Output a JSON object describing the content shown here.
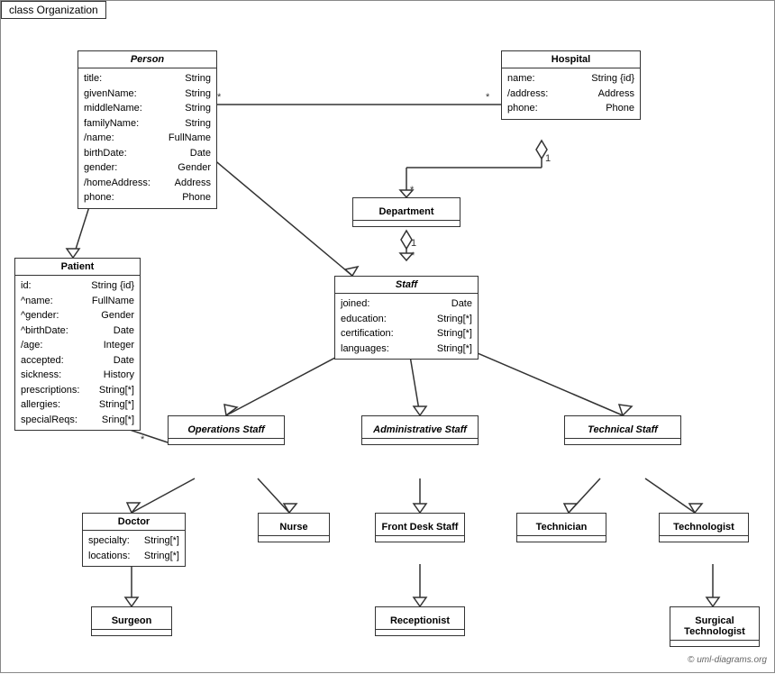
{
  "title": "class Organization",
  "watermark": "© uml-diagrams.org",
  "boxes": {
    "person": {
      "title": "Person",
      "attrs": [
        [
          "title:",
          "String"
        ],
        [
          "givenName:",
          "String"
        ],
        [
          "middleName:",
          "String"
        ],
        [
          "familyName:",
          "String"
        ],
        [
          "/name:",
          "FullName"
        ],
        [
          "birthDate:",
          "Date"
        ],
        [
          "gender:",
          "Gender"
        ],
        [
          "/homeAddress:",
          "Address"
        ],
        [
          "phone:",
          "Phone"
        ]
      ]
    },
    "hospital": {
      "title": "Hospital",
      "attrs": [
        [
          "name:",
          "String {id}"
        ],
        [
          "/address:",
          "Address"
        ],
        [
          "phone:",
          "Phone"
        ]
      ]
    },
    "department": {
      "title": "Department",
      "attrs": []
    },
    "staff": {
      "title": "Staff",
      "attrs": [
        [
          "joined:",
          "Date"
        ],
        [
          "education:",
          "String[*]"
        ],
        [
          "certification:",
          "String[*]"
        ],
        [
          "languages:",
          "String[*]"
        ]
      ]
    },
    "patient": {
      "title": "Patient",
      "attrs": [
        [
          "id:",
          "String {id}"
        ],
        [
          "^name:",
          "FullName"
        ],
        [
          "^gender:",
          "Gender"
        ],
        [
          "^birthDate:",
          "Date"
        ],
        [
          "/age:",
          "Integer"
        ],
        [
          "accepted:",
          "Date"
        ],
        [
          "sickness:",
          "History"
        ],
        [
          "prescriptions:",
          "String[*]"
        ],
        [
          "allergies:",
          "String[*]"
        ],
        [
          "specialReqs:",
          "Sring[*]"
        ]
      ]
    },
    "operationsStaff": {
      "title": "Operations Staff",
      "italic": true
    },
    "administrativeStaff": {
      "title": "Administrative Staff",
      "italic": true
    },
    "technicalStaff": {
      "title": "Technical Staff",
      "italic": true
    },
    "doctor": {
      "title": "Doctor",
      "attrs": [
        [
          "specialty:",
          "String[*]"
        ],
        [
          "locations:",
          "String[*]"
        ]
      ]
    },
    "nurse": {
      "title": "Nurse",
      "attrs": []
    },
    "frontDeskStaff": {
      "title": "Front Desk Staff",
      "attrs": []
    },
    "technician": {
      "title": "Technician",
      "attrs": []
    },
    "technologist": {
      "title": "Technologist",
      "attrs": []
    },
    "surgeon": {
      "title": "Surgeon",
      "attrs": []
    },
    "receptionist": {
      "title": "Receptionist",
      "attrs": []
    },
    "surgicalTechnologist": {
      "title": "Surgical Technologist",
      "attrs": []
    }
  }
}
